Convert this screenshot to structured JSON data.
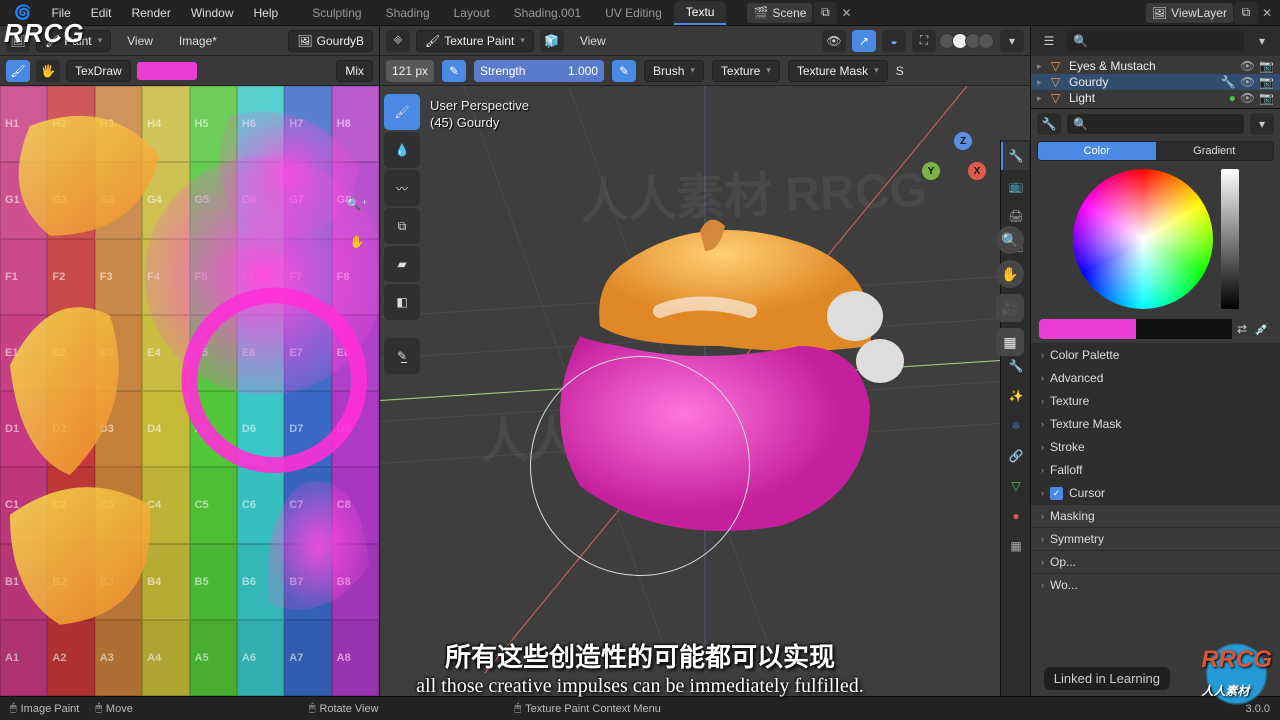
{
  "app": {
    "menus": [
      "File",
      "Edit",
      "Render",
      "Window",
      "Help"
    ],
    "workspaces": [
      "Sculpting",
      "Shading",
      "Layout",
      "Shading.001",
      "UV Editing",
      "Textu"
    ],
    "active_workspace_index": 5,
    "scene_label": "Scene",
    "viewlayer_label": "ViewLayer"
  },
  "image_editor": {
    "mode": "Paint",
    "menus": [
      "View",
      "Image*"
    ],
    "image_name": "GourdyB",
    "brush_name": "TexDraw",
    "blend_label": "Mix",
    "uv_rows": [
      "H",
      "G",
      "F",
      "E",
      "D",
      "C",
      "B",
      "A"
    ]
  },
  "viewport": {
    "mode": "Texture Paint",
    "menus": [
      "View"
    ],
    "overlay_label_line1": "User Perspective",
    "overlay_label_line2": "(45) Gourdy",
    "radius_label": "121 px",
    "strength_label": "Strength",
    "strength_value": "1.000",
    "header_dropdowns": [
      "Brush",
      "Texture",
      "Texture Mask"
    ],
    "header_tail": "S"
  },
  "outliner": {
    "items": [
      {
        "label": "Eyes & Mustach"
      },
      {
        "label": "Gourdy",
        "selected": true
      },
      {
        "label": "Light"
      }
    ]
  },
  "properties": {
    "tabs": {
      "color": "Color",
      "gradient": "Gradient",
      "active": "color"
    },
    "panels": [
      "Color Palette",
      "Advanced",
      "Texture",
      "Texture Mask",
      "Stroke",
      "Falloff",
      "Cursor",
      "Masking",
      "Symmetry"
    ],
    "cursor_checked": true
  },
  "status": {
    "items": [
      "Image Paint",
      "Move",
      "Rotate View",
      "Texture Paint Context Menu"
    ],
    "version": "3.0.0"
  },
  "subtitles": {
    "cn": "所有这些创造性的可能都可以实现",
    "en": "all those creative impulses can be immediately fulfilled."
  },
  "watermarks": {
    "tl": "RRCG",
    "br": "RRCG",
    "linkedin": "Linked in Learning"
  }
}
